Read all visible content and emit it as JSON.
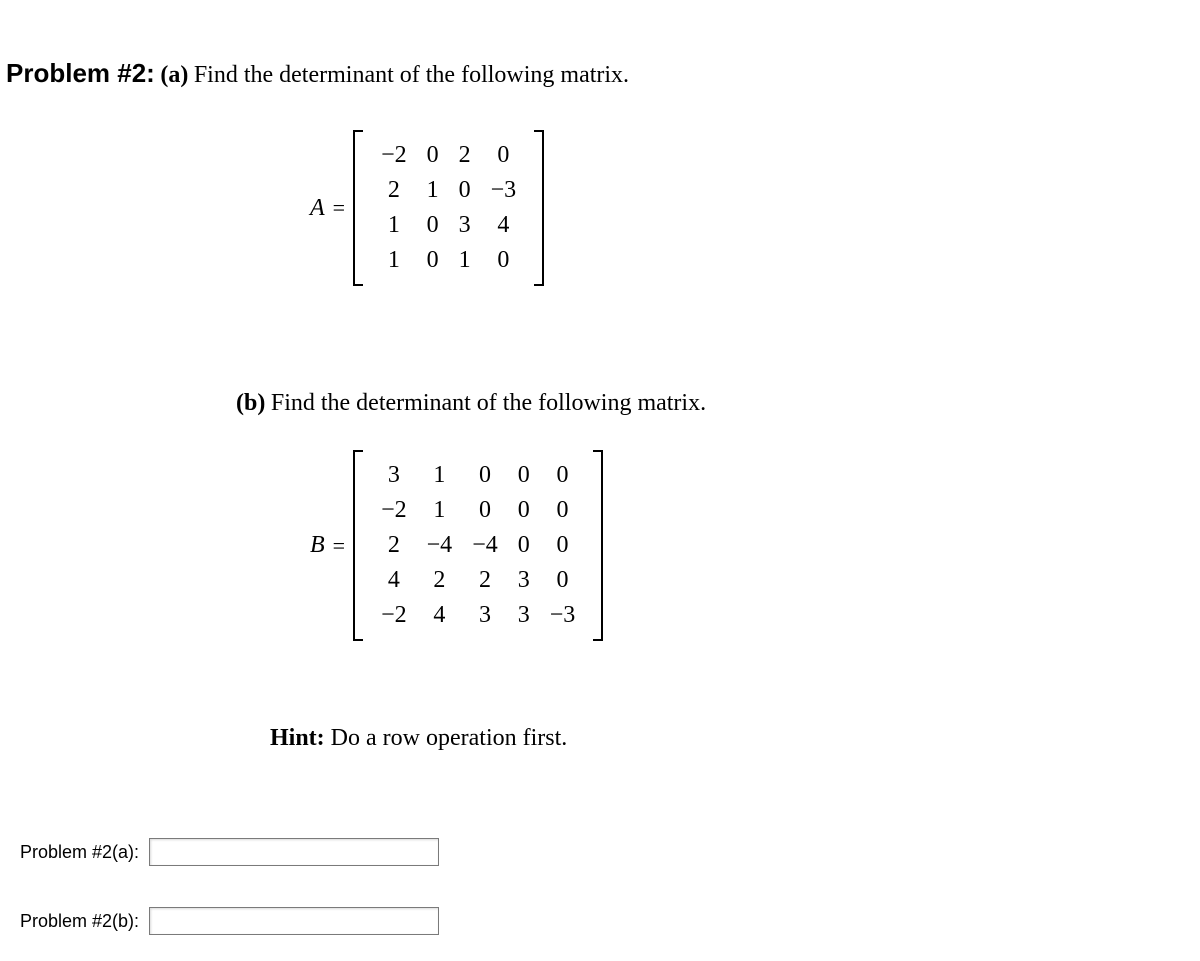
{
  "problem": {
    "number_label": "Problem #2:",
    "a": {
      "label": "(a)",
      "text": "Find the determinant of the following matrix.",
      "matrix_name": "A",
      "eq": "=",
      "rows": [
        [
          "−2",
          "0",
          "2",
          "0"
        ],
        [
          "2",
          "1",
          "0",
          "−3"
        ],
        [
          "1",
          "0",
          "3",
          "4"
        ],
        [
          "1",
          "0",
          "1",
          "0"
        ]
      ]
    },
    "b": {
      "label": "(b)",
      "text": "Find the determinant of the following matrix.",
      "matrix_name": "B",
      "eq": "=",
      "rows": [
        [
          "3",
          "1",
          "0",
          "0",
          "0"
        ],
        [
          "−2",
          "1",
          "0",
          "0",
          "0"
        ],
        [
          "2",
          "−4",
          "−4",
          "0",
          "0"
        ],
        [
          "4",
          "2",
          "2",
          "3",
          "0"
        ],
        [
          "−2",
          "4",
          "3",
          "3",
          "−3"
        ]
      ]
    },
    "hint": {
      "bold": "Hint:",
      "text": " Do a row operation first."
    }
  },
  "answers": {
    "a": {
      "label": "Problem #2(a):",
      "value": ""
    },
    "b": {
      "label": "Problem #2(b):",
      "value": ""
    }
  }
}
